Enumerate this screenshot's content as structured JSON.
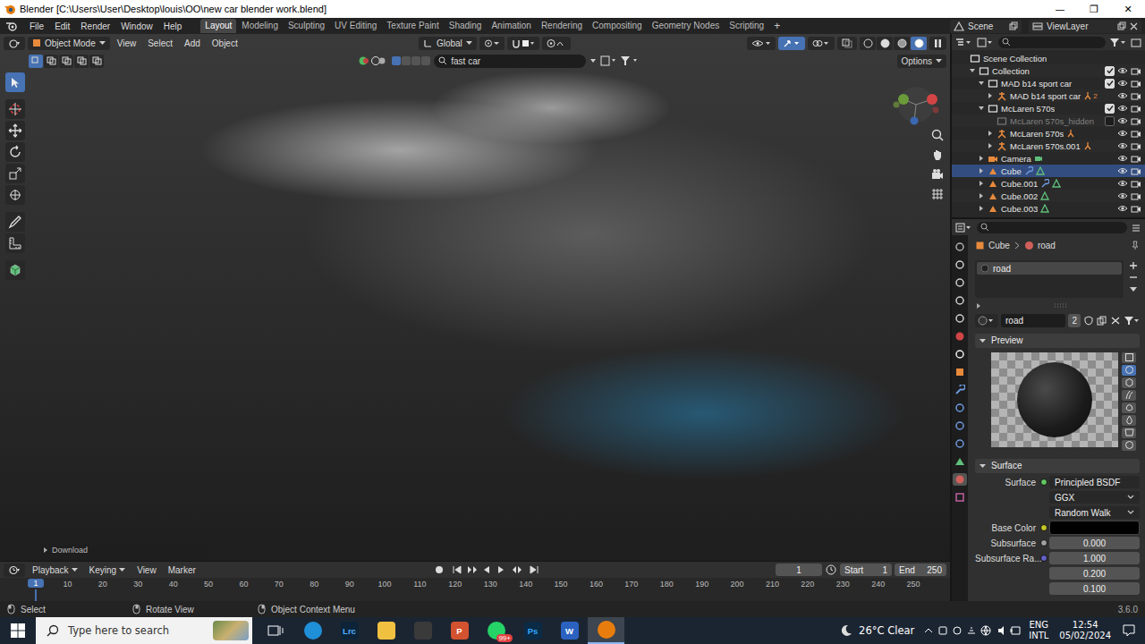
{
  "window": {
    "title": "Blender [C:\\Users\\User\\Desktop\\louis\\OO\\new car blender work.blend]",
    "controls": [
      "—",
      "❐",
      "✕"
    ]
  },
  "menu": [
    "File",
    "Edit",
    "Render",
    "Window",
    "Help"
  ],
  "workspaces": [
    {
      "label": "Layout",
      "selected": true
    },
    {
      "label": "Modeling",
      "selected": false
    },
    {
      "label": "Sculpting",
      "selected": false
    },
    {
      "label": "UV Editing",
      "selected": false
    },
    {
      "label": "Texture Paint",
      "selected": false
    },
    {
      "label": "Shading",
      "selected": false
    },
    {
      "label": "Animation",
      "selected": false
    },
    {
      "label": "Rendering",
      "selected": false
    },
    {
      "label": "Compositing",
      "selected": false
    },
    {
      "label": "Geometry Nodes",
      "selected": false
    },
    {
      "label": "Scripting",
      "selected": false
    }
  ],
  "add_workspace": "+",
  "scene": "Scene",
  "view_layer": "ViewLayer",
  "viewport": {
    "mode": "Object Mode",
    "menus": [
      "View",
      "Select",
      "Add",
      "Object"
    ],
    "orientation": "Global",
    "search": "fast car",
    "options": "Options",
    "overlay_label": "Download",
    "tools": [
      {
        "name": "select-box",
        "selected": true
      },
      {
        "name": "cursor",
        "selected": false
      },
      {
        "name": "move",
        "selected": false
      },
      {
        "name": "rotate",
        "selected": false
      },
      {
        "name": "scale",
        "selected": false
      },
      {
        "name": "transform",
        "selected": false
      },
      {
        "name": "annotate",
        "selected": false
      },
      {
        "name": "measure",
        "selected": false
      },
      {
        "name": "add-cube",
        "selected": false
      }
    ],
    "select_modes": [
      {
        "name": "set",
        "selected": true
      },
      {
        "name": "extend",
        "selected": false
      },
      {
        "name": "subtract",
        "selected": false
      },
      {
        "name": "difference",
        "selected": false
      },
      {
        "name": "intersect",
        "selected": false
      }
    ],
    "shading": [
      {
        "name": "wireframe",
        "selected": false
      },
      {
        "name": "solid",
        "selected": false
      },
      {
        "name": "material",
        "selected": false
      },
      {
        "name": "rendered",
        "selected": true
      }
    ]
  },
  "outliner": {
    "items": [
      {
        "label": "Scene Collection",
        "kind": "scene",
        "depth": 0,
        "expandable": false,
        "expanded": true,
        "checked": true,
        "selected": false,
        "disabled": false,
        "modifier": false
      },
      {
        "label": "Collection",
        "kind": "collection",
        "depth": 1,
        "expandable": true,
        "expanded": true,
        "checked": true,
        "selected": false,
        "disabled": false,
        "modifier": false
      },
      {
        "label": "MAD b14 sport car",
        "kind": "collection",
        "depth": 2,
        "expandable": true,
        "expanded": true,
        "checked": true,
        "selected": false,
        "disabled": false,
        "modifier": false
      },
      {
        "label": "MAD b14 sport car",
        "kind": "armature",
        "depth": 3,
        "expandable": true,
        "expanded": false,
        "checked": true,
        "selected": false,
        "disabled": false,
        "modifier": false,
        "count": "2"
      },
      {
        "label": "McLaren 570s",
        "kind": "collection",
        "depth": 2,
        "expandable": true,
        "expanded": true,
        "checked": true,
        "selected": false,
        "disabled": false,
        "modifier": false
      },
      {
        "label": "McLaren 570s_hidden",
        "kind": "collection",
        "depth": 3,
        "expandable": false,
        "expanded": false,
        "checked": false,
        "selected": false,
        "disabled": true,
        "modifier": false
      },
      {
        "label": "McLaren 570s",
        "kind": "armature",
        "depth": 3,
        "expandable": true,
        "expanded": false,
        "checked": true,
        "selected": false,
        "disabled": false,
        "modifier": false
      },
      {
        "label": "McLaren 570s.001",
        "kind": "armature",
        "depth": 3,
        "expandable": true,
        "expanded": false,
        "checked": true,
        "selected": false,
        "disabled": false,
        "modifier": false
      },
      {
        "label": "Camera",
        "kind": "camera",
        "depth": 2,
        "expandable": true,
        "expanded": false,
        "checked": true,
        "selected": false,
        "disabled": false,
        "modifier": false
      },
      {
        "label": "Cube",
        "kind": "mesh",
        "depth": 2,
        "expandable": true,
        "expanded": false,
        "checked": true,
        "selected": true,
        "disabled": false,
        "modifier": true
      },
      {
        "label": "Cube.001",
        "kind": "mesh",
        "depth": 2,
        "expandable": true,
        "expanded": false,
        "checked": true,
        "selected": false,
        "disabled": false,
        "modifier": true
      },
      {
        "label": "Cube.002",
        "kind": "mesh",
        "depth": 2,
        "expandable": true,
        "expanded": false,
        "checked": true,
        "selected": false,
        "disabled": false,
        "modifier": false
      },
      {
        "label": "Cube.003",
        "kind": "mesh",
        "depth": 2,
        "expandable": true,
        "expanded": false,
        "checked": true,
        "selected": false,
        "disabled": false,
        "modifier": false
      }
    ]
  },
  "properties": {
    "tabs": [
      {
        "name": "tool",
        "selected": false
      },
      {
        "name": "render",
        "selected": false
      },
      {
        "name": "output",
        "selected": false
      },
      {
        "name": "view-layer",
        "selected": false
      },
      {
        "name": "scene",
        "selected": false
      },
      {
        "name": "world",
        "selected": false
      },
      {
        "name": "collection",
        "selected": false
      },
      {
        "name": "object",
        "selected": false
      },
      {
        "name": "modifiers",
        "selected": false
      },
      {
        "name": "particles",
        "selected": false
      },
      {
        "name": "physics",
        "selected": false
      },
      {
        "name": "constraints",
        "selected": false
      },
      {
        "name": "data",
        "selected": false
      },
      {
        "name": "material",
        "selected": true
      },
      {
        "name": "texture",
        "selected": false
      }
    ],
    "breadcrumb": [
      "Cube",
      "road"
    ],
    "slots": [
      {
        "label": "road",
        "selected": true
      }
    ],
    "material": {
      "name": "road",
      "users": "2"
    },
    "preview": {
      "title": "Preview",
      "expanded": true,
      "shapes": [
        {
          "name": "flat",
          "selected": false
        },
        {
          "name": "sphere",
          "selected": true
        },
        {
          "name": "cube",
          "selected": false
        },
        {
          "name": "hair",
          "selected": false
        },
        {
          "name": "monkey",
          "selected": false
        },
        {
          "name": "fluid",
          "selected": false
        },
        {
          "name": "cloth",
          "selected": false
        },
        {
          "name": "world",
          "selected": false
        }
      ]
    },
    "surface": {
      "title": "Surface",
      "expanded": true,
      "fields": [
        {
          "label": "Surface",
          "value": "Principled BSDF",
          "kind": "shader",
          "color": "#63c763"
        },
        {
          "label": "",
          "value": "GGX",
          "kind": "dropdown"
        },
        {
          "label": "",
          "value": "Random Walk",
          "kind": "dropdown"
        },
        {
          "label": "Base Color",
          "value": "",
          "kind": "color",
          "color": "#c7c729",
          "swatch": "#000000"
        },
        {
          "label": "Subsurface",
          "value": "0.000",
          "kind": "number",
          "color": "#a1a1a1"
        },
        {
          "label": "Subsurface Ra...",
          "value": "1.000",
          "kind": "number",
          "color": "#6363c7"
        },
        {
          "label": "",
          "value": "0.200",
          "kind": "number"
        },
        {
          "label": "",
          "value": "0.100",
          "kind": "number"
        }
      ]
    }
  },
  "timeline": {
    "menus": [
      "Playback",
      "Keying",
      "View",
      "Marker"
    ],
    "current_frame": "1",
    "start_label": "Start",
    "start": "1",
    "end_label": "End",
    "end": "250",
    "ticks": [
      "1",
      "10",
      "20",
      "30",
      "40",
      "50",
      "60",
      "70",
      "80",
      "90",
      "100",
      "110",
      "120",
      "130",
      "140",
      "150",
      "160",
      "170",
      "180",
      "190",
      "200",
      "210",
      "220",
      "230",
      "240",
      "250"
    ]
  },
  "status_bar": {
    "items": [
      "Select",
      "Rotate View",
      "Object Context Menu"
    ],
    "version": "3.6.0"
  },
  "taskbar": {
    "search": "Type here to search",
    "apps": [
      {
        "kind": "task-view",
        "active": false
      },
      {
        "kind": "edge",
        "active": false
      },
      {
        "kind": "lightroom",
        "label": "Lrc",
        "active": false
      },
      {
        "kind": "explorer",
        "active": false
      },
      {
        "kind": "store",
        "active": false
      },
      {
        "kind": "powerpoint",
        "label": "P",
        "active": false
      },
      {
        "kind": "whatsapp",
        "badge": "99+",
        "active": false
      },
      {
        "kind": "photoshop",
        "label": "Ps",
        "active": false
      },
      {
        "kind": "word",
        "label": "W",
        "active": false
      },
      {
        "kind": "blender",
        "active": true
      }
    ],
    "weather": "26°C Clear",
    "language": "ENG",
    "layout": "INTL",
    "time": "12:54",
    "date": "05/02/2024"
  }
}
